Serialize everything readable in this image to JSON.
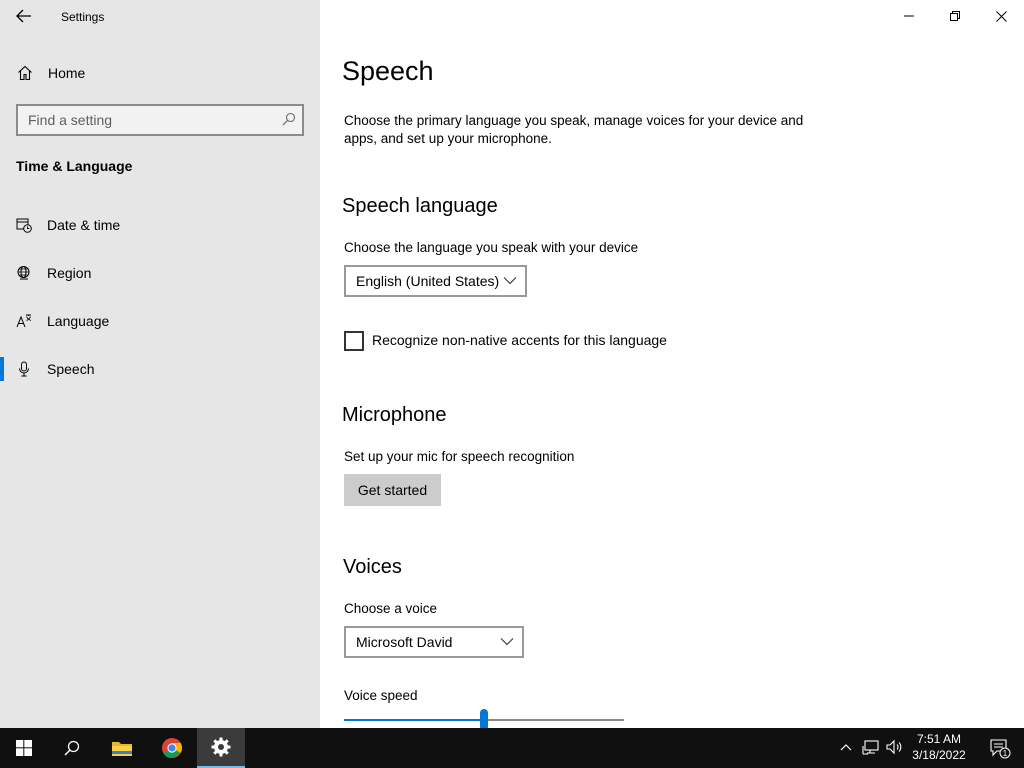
{
  "window": {
    "title": "Settings",
    "controls": [
      "minimize",
      "restore",
      "close"
    ]
  },
  "sidebar": {
    "home_label": "Home",
    "search_placeholder": "Find a setting",
    "section_title": "Time & Language",
    "items": [
      {
        "label": "Date & time",
        "icon": "date-time-icon",
        "active": false
      },
      {
        "label": "Region",
        "icon": "globe-icon",
        "active": false
      },
      {
        "label": "Language",
        "icon": "language-icon",
        "active": false
      },
      {
        "label": "Speech",
        "icon": "microphone-icon",
        "active": true
      }
    ]
  },
  "main": {
    "title": "Speech",
    "description": "Choose the primary language you speak, manage voices for your device and apps, and set up your microphone.",
    "speech_language": {
      "heading": "Speech language",
      "label": "Choose the language you speak with your device",
      "selected": "English (United States)",
      "checkbox_label": "Recognize non-native accents for this language",
      "checkbox_checked": false
    },
    "microphone": {
      "heading": "Microphone",
      "label": "Set up your mic for speech recognition",
      "button": "Get started"
    },
    "voices": {
      "heading": "Voices",
      "label": "Choose a voice",
      "selected": "Microsoft David",
      "speed_label": "Voice speed",
      "speed_value": 0.5
    }
  },
  "taskbar": {
    "time": "7:51 AM",
    "date": "3/18/2022",
    "notification_count": "1",
    "accent": "#0078d7"
  }
}
